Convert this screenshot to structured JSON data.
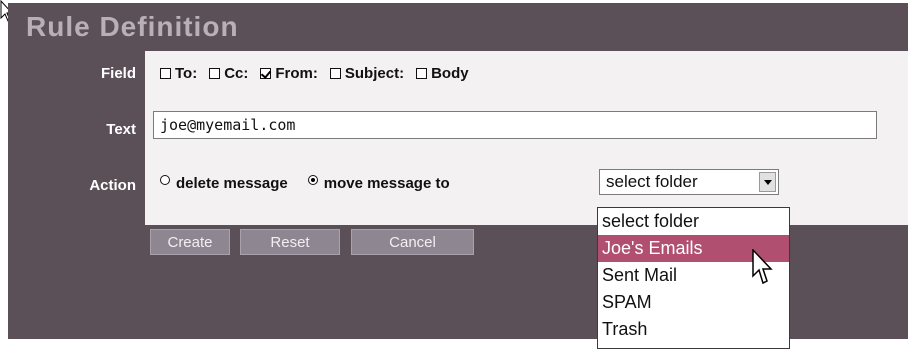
{
  "title": "Rule Definition",
  "labels": {
    "field": "Field",
    "text": "Text",
    "action": "Action"
  },
  "fields": [
    {
      "label": "To:",
      "checked": false
    },
    {
      "label": "Cc:",
      "checked": false
    },
    {
      "label": "From:",
      "checked": true
    },
    {
      "label": "Subject:",
      "checked": false
    },
    {
      "label": "Body",
      "checked": false
    }
  ],
  "text_value": "joe@myemail.com",
  "actions": [
    {
      "label": "delete message",
      "selected": false
    },
    {
      "label": "move message to",
      "selected": true
    }
  ],
  "folder_select": {
    "value": "select folder",
    "options": [
      "select folder",
      "Joe's Emails",
      "Sent Mail",
      "SPAM",
      "Trash"
    ],
    "highlighted": "Joe's Emails"
  },
  "buttons": {
    "create": "Create",
    "reset": "Reset",
    "cancel": "Cancel"
  },
  "colors": {
    "panel": "#5c5058",
    "title": "#b9b0b6",
    "content_bg": "#f3f1f1",
    "button_bg": "#8e8690",
    "highlight": "#b04f70"
  }
}
